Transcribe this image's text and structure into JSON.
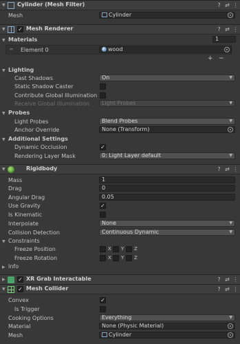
{
  "mesh_filter": {
    "title": "Cylinder (Mesh Filter)",
    "mesh_label": "Mesh",
    "mesh_value": "Cylinder"
  },
  "mesh_renderer": {
    "title": "Mesh Renderer",
    "materials_label": "Materials",
    "materials_count": "1",
    "element0_label": "Element 0",
    "element0_value": "wood",
    "add_symbol": "+",
    "remove_symbol": "−",
    "lighting_label": "Lighting",
    "cast_shadows_label": "Cast Shadows",
    "cast_shadows_value": "On",
    "static_shadow_label": "Static Shadow Caster",
    "contribute_gi_label": "Contribute Global Illumination",
    "receive_gi_label": "Receive Global Illumination",
    "receive_gi_value": "Light Probes",
    "probes_label": "Probes",
    "light_probes_label": "Light Probes",
    "light_probes_value": "Blend Probes",
    "anchor_label": "Anchor Override",
    "anchor_value": "None (Transform)",
    "additional_label": "Additional Settings",
    "dynamic_occlusion_label": "Dynamic Occlusion",
    "layer_mask_label": "Rendering Layer Mask",
    "layer_mask_value": "0: Light Layer default"
  },
  "rigidbody": {
    "title": "Rigidbody",
    "mass_label": "Mass",
    "mass_value": "1",
    "drag_label": "Drag",
    "drag_value": "0",
    "angular_drag_label": "Angular Drag",
    "angular_drag_value": "0.05",
    "use_gravity_label": "Use Gravity",
    "is_kinematic_label": "Is Kinematic",
    "interpolate_label": "Interpolate",
    "interpolate_value": "None",
    "collision_label": "Collision Detection",
    "collision_value": "Continuous Dynamic",
    "constraints_label": "Constraints",
    "freeze_pos_label": "Freeze Position",
    "freeze_rot_label": "Freeze Rotation",
    "axis_x": "X",
    "axis_y": "Y",
    "axis_z": "Z",
    "info_label": "Info"
  },
  "xr_grab": {
    "title": "XR Grab Interactable"
  },
  "mesh_collider": {
    "title": "Mesh Collider",
    "convex_label": "Convex",
    "is_trigger_label": "Is Trigger",
    "cooking_label": "Cooking Options",
    "cooking_value": "Everything",
    "material_label": "Material",
    "material_value": "None (Physic Material)",
    "mesh_label": "Mesh",
    "mesh_value": "Cylinder"
  },
  "header_buttons": {
    "help": "?",
    "presets": "⇄",
    "menu": "⋮"
  },
  "colors": {
    "background": "#383838",
    "header": "#3e3e3e",
    "field": "#2a2a2a",
    "dropdown": "#515151",
    "checkmark": "#dcdcdc"
  }
}
